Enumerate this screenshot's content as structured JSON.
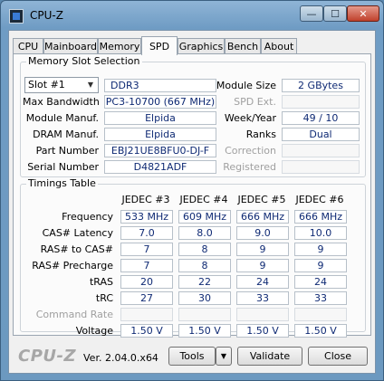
{
  "window": {
    "title": "CPU-Z",
    "min_glyph": "—",
    "max_glyph": "☐",
    "close_glyph": "✕"
  },
  "tabs": [
    "CPU",
    "Mainboard",
    "Memory",
    "SPD",
    "Graphics",
    "Bench",
    "About"
  ],
  "active_tab": "SPD",
  "memory_slot": {
    "group_title": "Memory Slot Selection",
    "slot": "Slot #1",
    "memory_type": "DDR3",
    "max_bandwidth_label": "Max Bandwidth",
    "max_bandwidth": "PC3-10700 (667 MHz)",
    "module_manuf_label": "Module Manuf.",
    "module_manuf": "Elpida",
    "dram_manuf_label": "DRAM Manuf.",
    "dram_manuf": "Elpida",
    "part_number_label": "Part Number",
    "part_number": "EBJ21UE8BFU0-DJ-F",
    "serial_number_label": "Serial Number",
    "serial_number": "D4821ADF",
    "module_size_label": "Module Size",
    "module_size": "2 GBytes",
    "spd_ext_label": "SPD Ext.",
    "spd_ext": "",
    "week_year_label": "Week/Year",
    "week_year": "49 / 10",
    "ranks_label": "Ranks",
    "ranks": "Dual",
    "correction_label": "Correction",
    "correction": "",
    "registered_label": "Registered",
    "registered": ""
  },
  "timings": {
    "group_title": "Timings Table",
    "columns": [
      "JEDEC #3",
      "JEDEC #4",
      "JEDEC #5",
      "JEDEC #6"
    ],
    "rows": [
      {
        "label": "Frequency",
        "values": [
          "533 MHz",
          "609 MHz",
          "666 MHz",
          "666 MHz"
        ],
        "disabled": false
      },
      {
        "label": "CAS# Latency",
        "values": [
          "7.0",
          "8.0",
          "9.0",
          "10.0"
        ],
        "disabled": false
      },
      {
        "label": "RAS# to CAS#",
        "values": [
          "7",
          "8",
          "9",
          "9"
        ],
        "disabled": false
      },
      {
        "label": "RAS# Precharge",
        "values": [
          "7",
          "8",
          "9",
          "9"
        ],
        "disabled": false
      },
      {
        "label": "tRAS",
        "values": [
          "20",
          "22",
          "24",
          "24"
        ],
        "disabled": false
      },
      {
        "label": "tRC",
        "values": [
          "27",
          "30",
          "33",
          "33"
        ],
        "disabled": false
      },
      {
        "label": "Command Rate",
        "values": [
          "",
          "",
          "",
          ""
        ],
        "disabled": true
      },
      {
        "label": "Voltage",
        "values": [
          "1.50 V",
          "1.50 V",
          "1.50 V",
          "1.50 V"
        ],
        "disabled": false
      }
    ]
  },
  "footer": {
    "brand": "CPU-Z",
    "version": "Ver. 2.04.0.x64",
    "tools_label": "Tools",
    "validate_label": "Validate",
    "close_label": "Close"
  }
}
